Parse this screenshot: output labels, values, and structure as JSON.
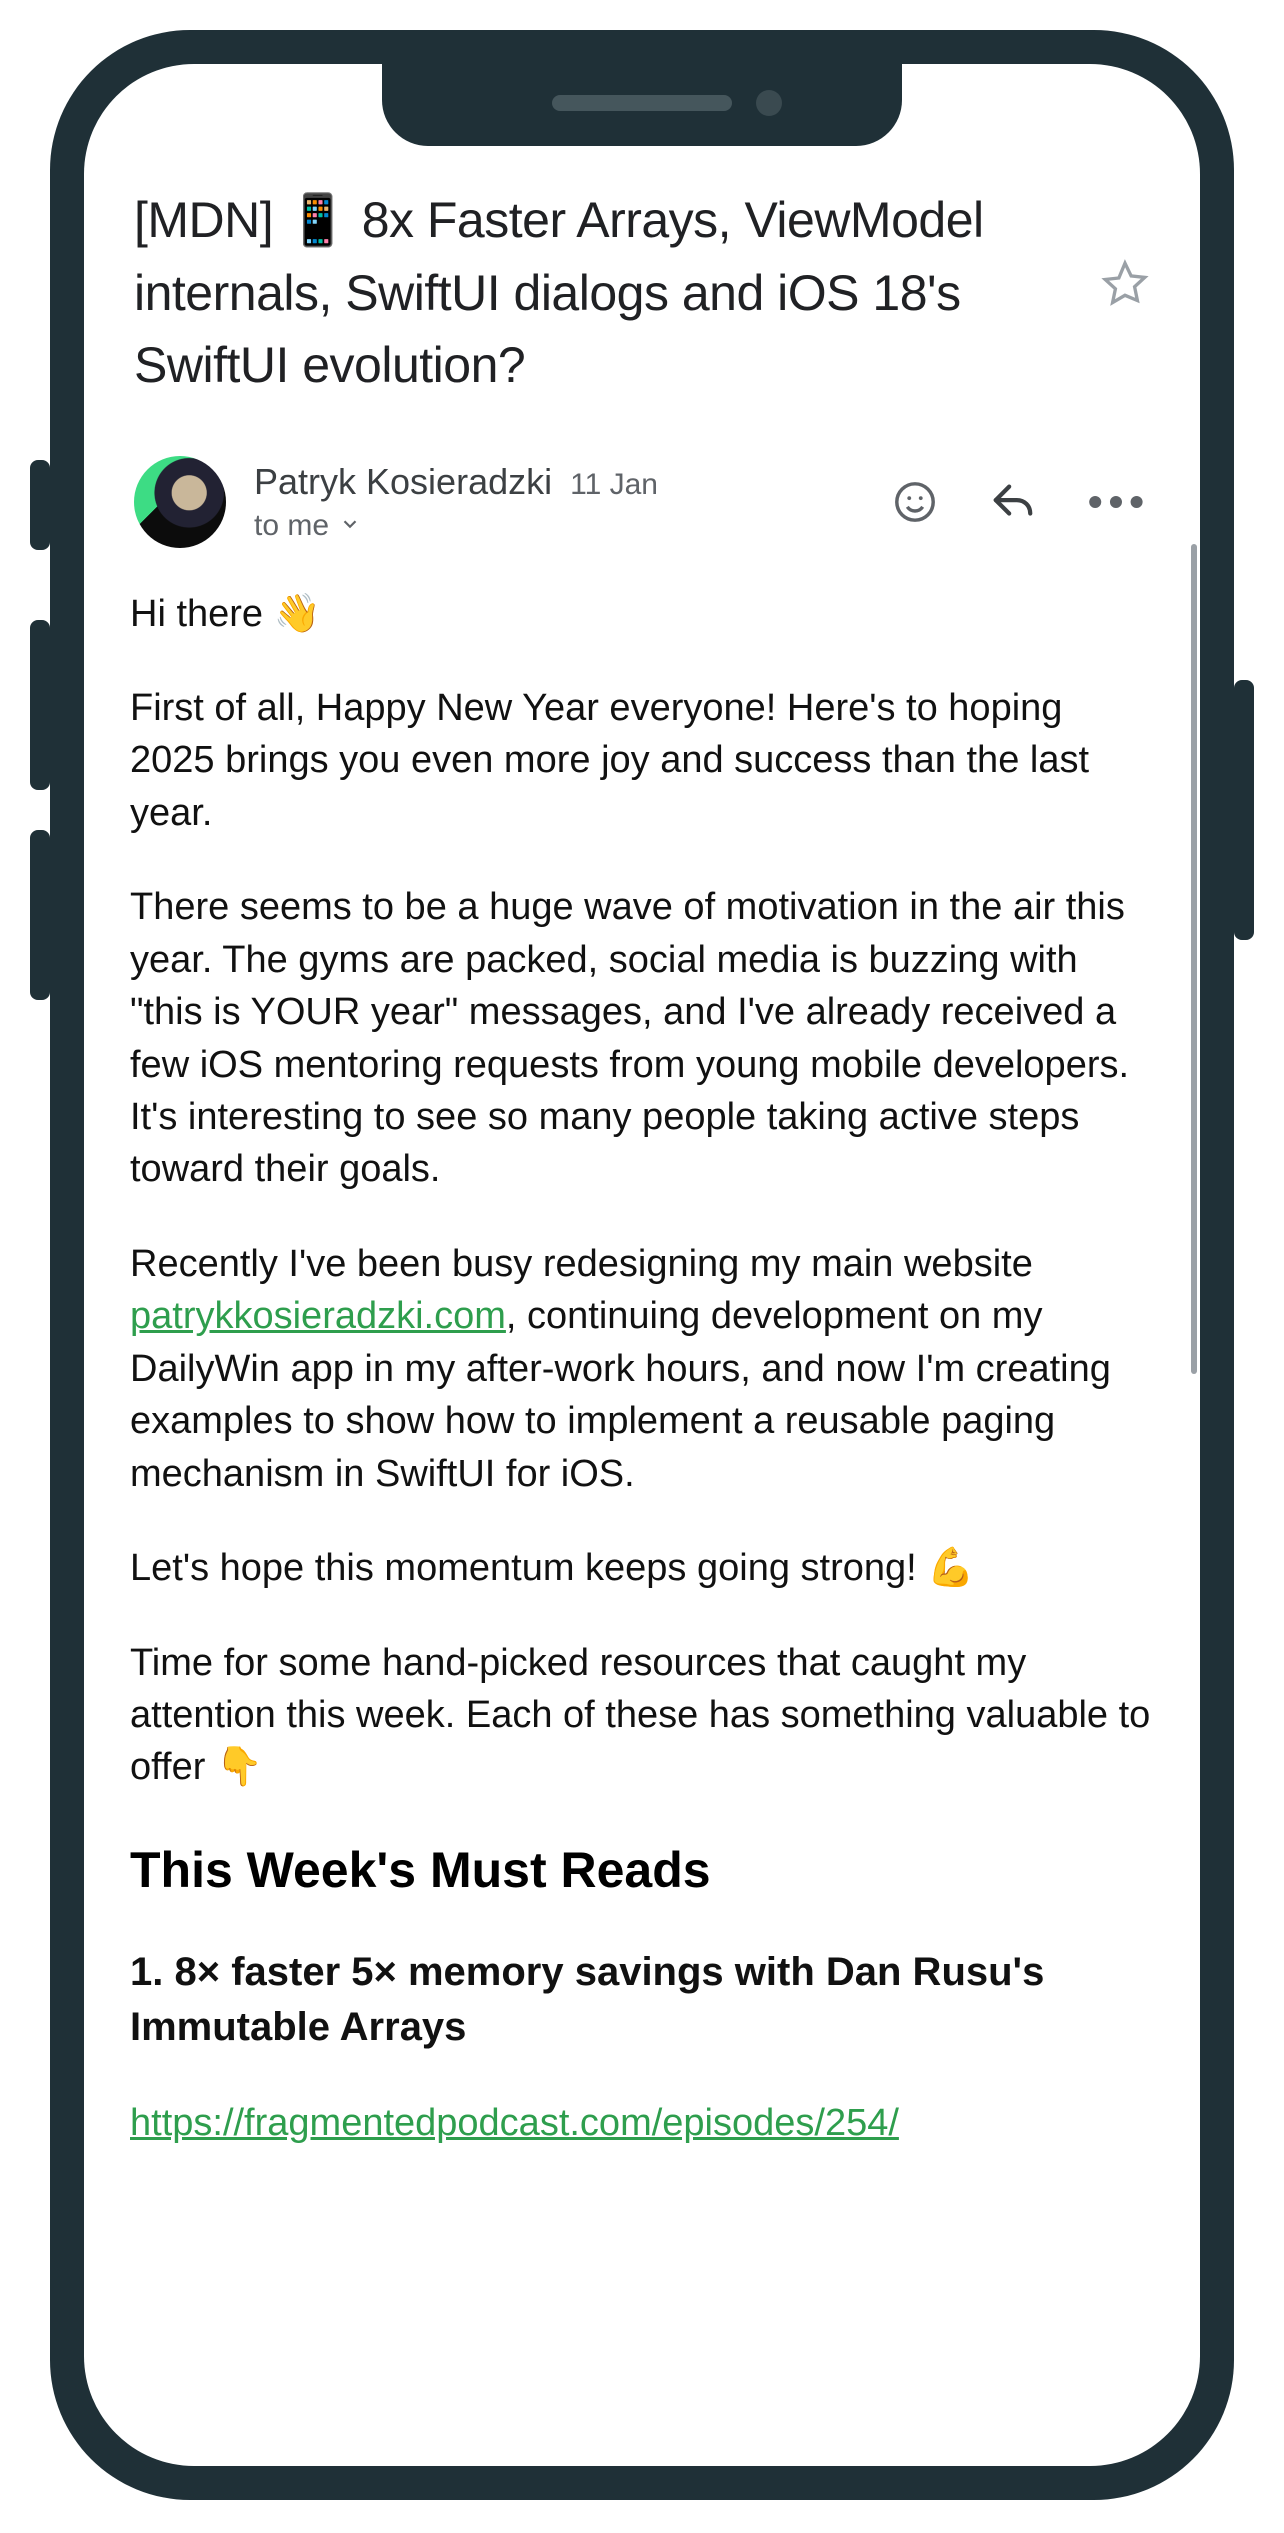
{
  "email": {
    "subject": "[MDN] 📱 8x Faster Arrays, ViewModel internals, SwiftUI dialogs and iOS 18's SwiftUI evolution?",
    "sender_name": "Patryk Kosieradzki",
    "date": "11 Jan",
    "to_line": "to me",
    "body": {
      "greeting": "Hi there 👋",
      "p1": "First of all, Happy New Year everyone! Here's to hoping 2025 brings you even more joy and success than the last year.",
      "p2": "There seems to be a huge wave of motivation in the air this year. The gyms are packed, social media is buzzing with \"this is YOUR year\" messages, and I've already received a few iOS mentoring requests from young mobile developers. It's interesting to see so many people taking active steps toward their goals.",
      "p3_a": "Recently I've been busy redesigning my main website ",
      "p3_link": "patrykkosieradzki.com",
      "p3_b": ", continuing development on my DailyWin app in my after-work hours, and now I'm creating examples to show how to implement a reusable paging mechanism in SwiftUI for iOS.",
      "p4": "Let's hope this momentum keeps going strong! 💪",
      "p5": "Time for some hand-picked resources that caught my attention this week. Each of these has something valuable to offer 👇",
      "section_heading": "This Week's Must Reads",
      "item1_title": "1. 8× faster 5× memory savings with Dan Rusu's Immutable Arrays",
      "item1_link": "https://fragmentedpodcast.com/episodes/254/"
    }
  }
}
